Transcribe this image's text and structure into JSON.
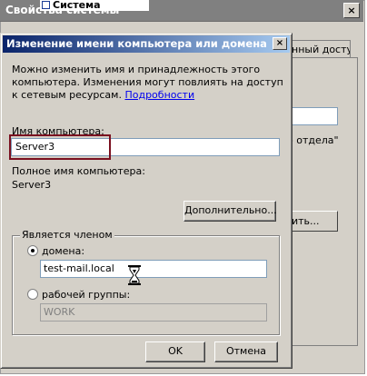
{
  "background_window": {
    "title": "Свойства системы",
    "close_glyph": "×",
    "tab_label": "нный доступ",
    "partial_text": "о отдела\"",
    "partial_button": "ить..."
  },
  "top_window": {
    "title": "Система"
  },
  "dialog": {
    "title": "Изменение имени компьютера или домена",
    "close_glyph": "×",
    "description": "Можно изменить имя и принадлежность этого компьютера. Изменения могут повлиять на доступ к сетевым ресурсам.",
    "details_link": "Подробности",
    "computer_name_label": "Имя компьютера:",
    "computer_name_value": "Server3",
    "full_name_label": "Полное имя компьютера:",
    "full_name_value": "Server3",
    "more_button": "Дополнительно...",
    "member_group_label": "Является членом",
    "domain_label": "домена:",
    "domain_value": "test-mail.local",
    "workgroup_label": "рабочей группы:",
    "workgroup_value": "WORK",
    "ok_button": "OK",
    "cancel_button": "Отмена"
  },
  "colors": {
    "title_gradient_start": "#0a246a",
    "title_gradient_end": "#a6caf0",
    "highlight_border": "#7a1020",
    "link": "#0000ee"
  }
}
